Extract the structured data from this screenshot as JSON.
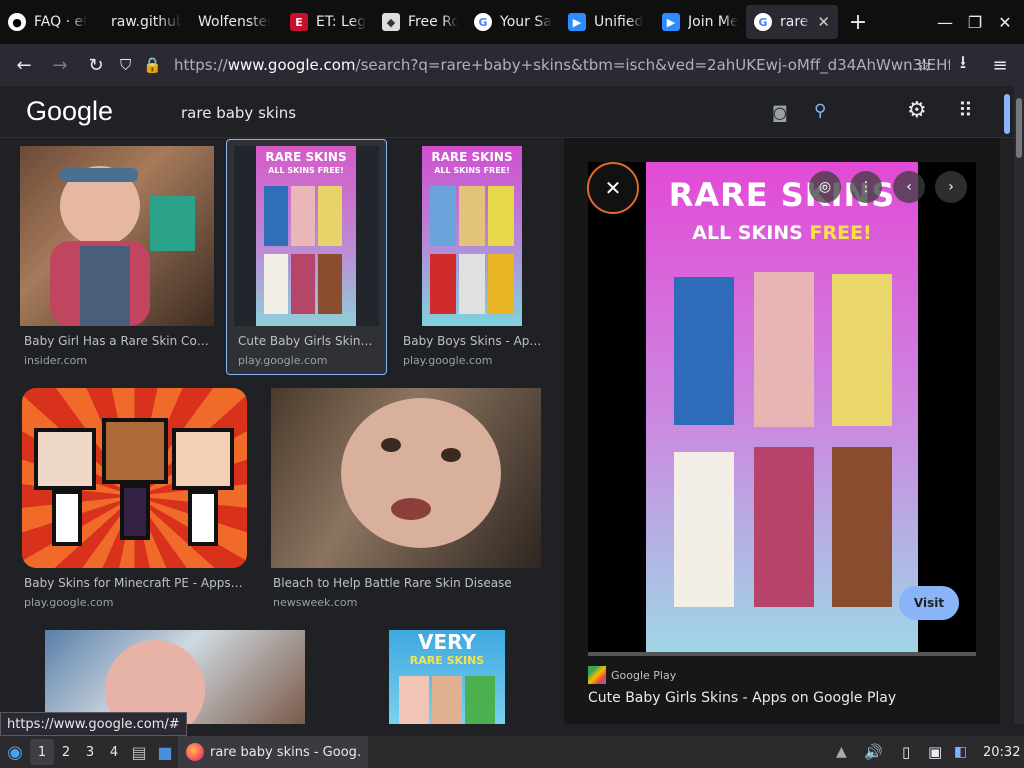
{
  "tabs": [
    {
      "label": "FAQ · et",
      "icon": "github-icon"
    },
    {
      "label": "raw.githubu",
      "icon": "blank-page-icon"
    },
    {
      "label": "Wolfenstei",
      "icon": "blank-page-icon"
    },
    {
      "label": "ET: Legi",
      "icon": "et-logo-icon"
    },
    {
      "label": "Free Ro",
      "icon": "roblox-icon"
    },
    {
      "label": "Your Sa",
      "icon": "google-icon"
    },
    {
      "label": "Unified",
      "icon": "zoom-icon"
    },
    {
      "label": "Join Me",
      "icon": "zoom-icon"
    },
    {
      "label": "rare b",
      "icon": "google-icon"
    }
  ],
  "url": {
    "scheme": "https://",
    "host": "www.google.com",
    "path": "/search?q=rare+baby+skins&tbm=isch&ved=2ahUKEwj-oMff_d34AhWwn3IEHf"
  },
  "google": {
    "logo": "Google",
    "query": "rare baby skins"
  },
  "results": [
    {
      "caption": "Baby Girl Has a Rare Skin Condi…",
      "source": "insider.com"
    },
    {
      "caption": "Cute Baby Girls Skins - …",
      "source": "play.google.com"
    },
    {
      "caption": "Baby Boys Skins - Apps…",
      "source": "play.google.com"
    },
    {
      "caption": "Baby Skins for Minecraft PE - Apps on …",
      "source": "play.google.com"
    },
    {
      "caption": "Bleach to Help Battle Rare Skin Disease",
      "source": "newsweek.com"
    }
  ],
  "thumb_text": {
    "rare_skins": "RARE SKINS",
    "all_free": "ALL SKINS FREE!",
    "very": "VERY",
    "very_rare": "RARE SKINS"
  },
  "preview": {
    "title_line1": "RARE SKINS",
    "title_line2_a": "ALL SKINS ",
    "title_line2_b": "FREE!",
    "source_name": "Google Play",
    "page_title": "Cute Baby Girls Skins - Apps on Google Play",
    "visit_label": "Visit"
  },
  "status_url": "https://www.google.com/#",
  "taskbar": {
    "workspaces": [
      "1",
      "2",
      "3",
      "4"
    ],
    "window_title": "rare baby skins - Goog…",
    "clock": "20:32"
  },
  "colors": {
    "accent": "#8ab4f8",
    "close_ring": "#e06a2c",
    "pink_bg": "#e24ad6"
  }
}
